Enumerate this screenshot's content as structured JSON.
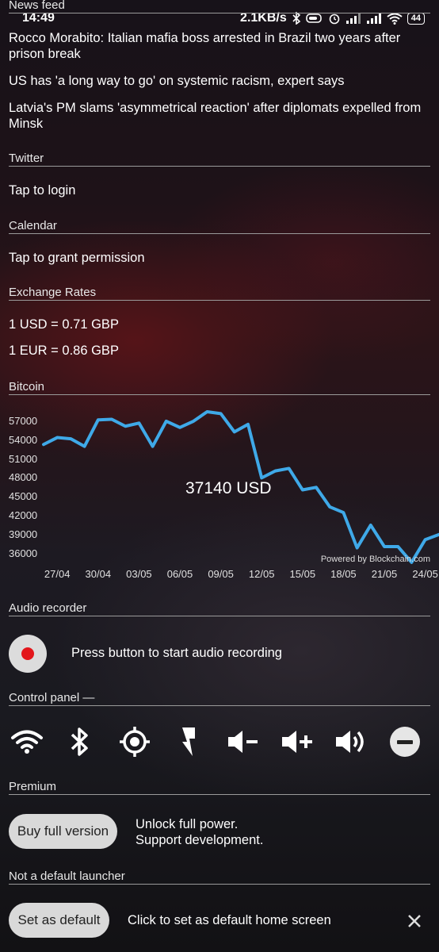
{
  "status_bar": {
    "time": "14:49",
    "net_speed": "2.1KB/s",
    "battery": "44",
    "icons": [
      "bluetooth-icon",
      "battery-saver-icon",
      "alarm-icon",
      "signal-icon",
      "signal-icon",
      "wifi-icon",
      "battery-icon"
    ]
  },
  "news": {
    "title": "News feed",
    "items": [
      "Rocco Morabito: Italian mafia boss arrested in Brazil two years after prison break",
      "US has 'a long way to go' on systemic racism, expert says",
      "Latvia's PM slams 'asymmetrical reaction' after diplomats expelled from Minsk"
    ]
  },
  "twitter": {
    "title": "Twitter",
    "action": "Tap to login"
  },
  "calendar": {
    "title": "Calendar",
    "action": "Tap to grant permission"
  },
  "exchange": {
    "title": "Exchange Rates",
    "rates": [
      "1 USD = 0.71 GBP",
      "1 EUR = 0.86 GBP"
    ]
  },
  "bitcoin": {
    "title": "Bitcoin",
    "current": "37140 USD",
    "powered": "Powered by Blockchain.com",
    "line_color": "#3fa9e8"
  },
  "chart_data": {
    "type": "line",
    "title": "Bitcoin",
    "xlabel": "",
    "ylabel": "",
    "x_tick_labels": [
      "27/04",
      "30/04",
      "03/05",
      "06/05",
      "09/05",
      "12/05",
      "15/05",
      "18/05",
      "21/05",
      "24/05"
    ],
    "y_tick_labels": [
      "57000",
      "54000",
      "51000",
      "48000",
      "45000",
      "42000",
      "39000",
      "36000"
    ],
    "ylim": [
      34200,
      59000
    ],
    "grid": false,
    "series": [
      {
        "x": [
          "26/04",
          "27/04",
          "28/04",
          "29/04",
          "30/04",
          "01/05",
          "02/05",
          "03/05",
          "04/05",
          "05/05",
          "06/05",
          "07/05",
          "08/05",
          "09/05",
          "10/05",
          "11/05",
          "12/05",
          "13/05",
          "14/05",
          "15/05",
          "16/05",
          "17/05",
          "18/05",
          "19/05",
          "20/05",
          "21/05",
          "22/05",
          "23/05",
          "24/05",
          "25/05"
        ],
        "values": [
          53300,
          54400,
          54200,
          53000,
          57200,
          57300,
          56200,
          56700,
          53000,
          57000,
          56000,
          57000,
          58500,
          58200,
          55300,
          56500,
          48000,
          49100,
          49500,
          46100,
          46500,
          43400,
          42500,
          36900,
          40500,
          37100,
          37100,
          34600,
          38200,
          39000
        ]
      }
    ]
  },
  "audio": {
    "title": "Audio recorder",
    "hint": "Press button to start audio recording"
  },
  "control_panel": {
    "title": "Control panel",
    "dash": "—",
    "icons": [
      "wifi-icon",
      "bluetooth-icon",
      "location-icon",
      "flashlight-icon",
      "volume-down-icon",
      "volume-up-icon",
      "volume-icon",
      "do-not-disturb-icon"
    ]
  },
  "premium": {
    "title": "Premium",
    "button": "Buy full version",
    "line1": "Unlock full power.",
    "line2": "Support development."
  },
  "launcher": {
    "title": "Not a default launcher",
    "button": "Set as default",
    "hint": "Click to set as default home screen"
  }
}
